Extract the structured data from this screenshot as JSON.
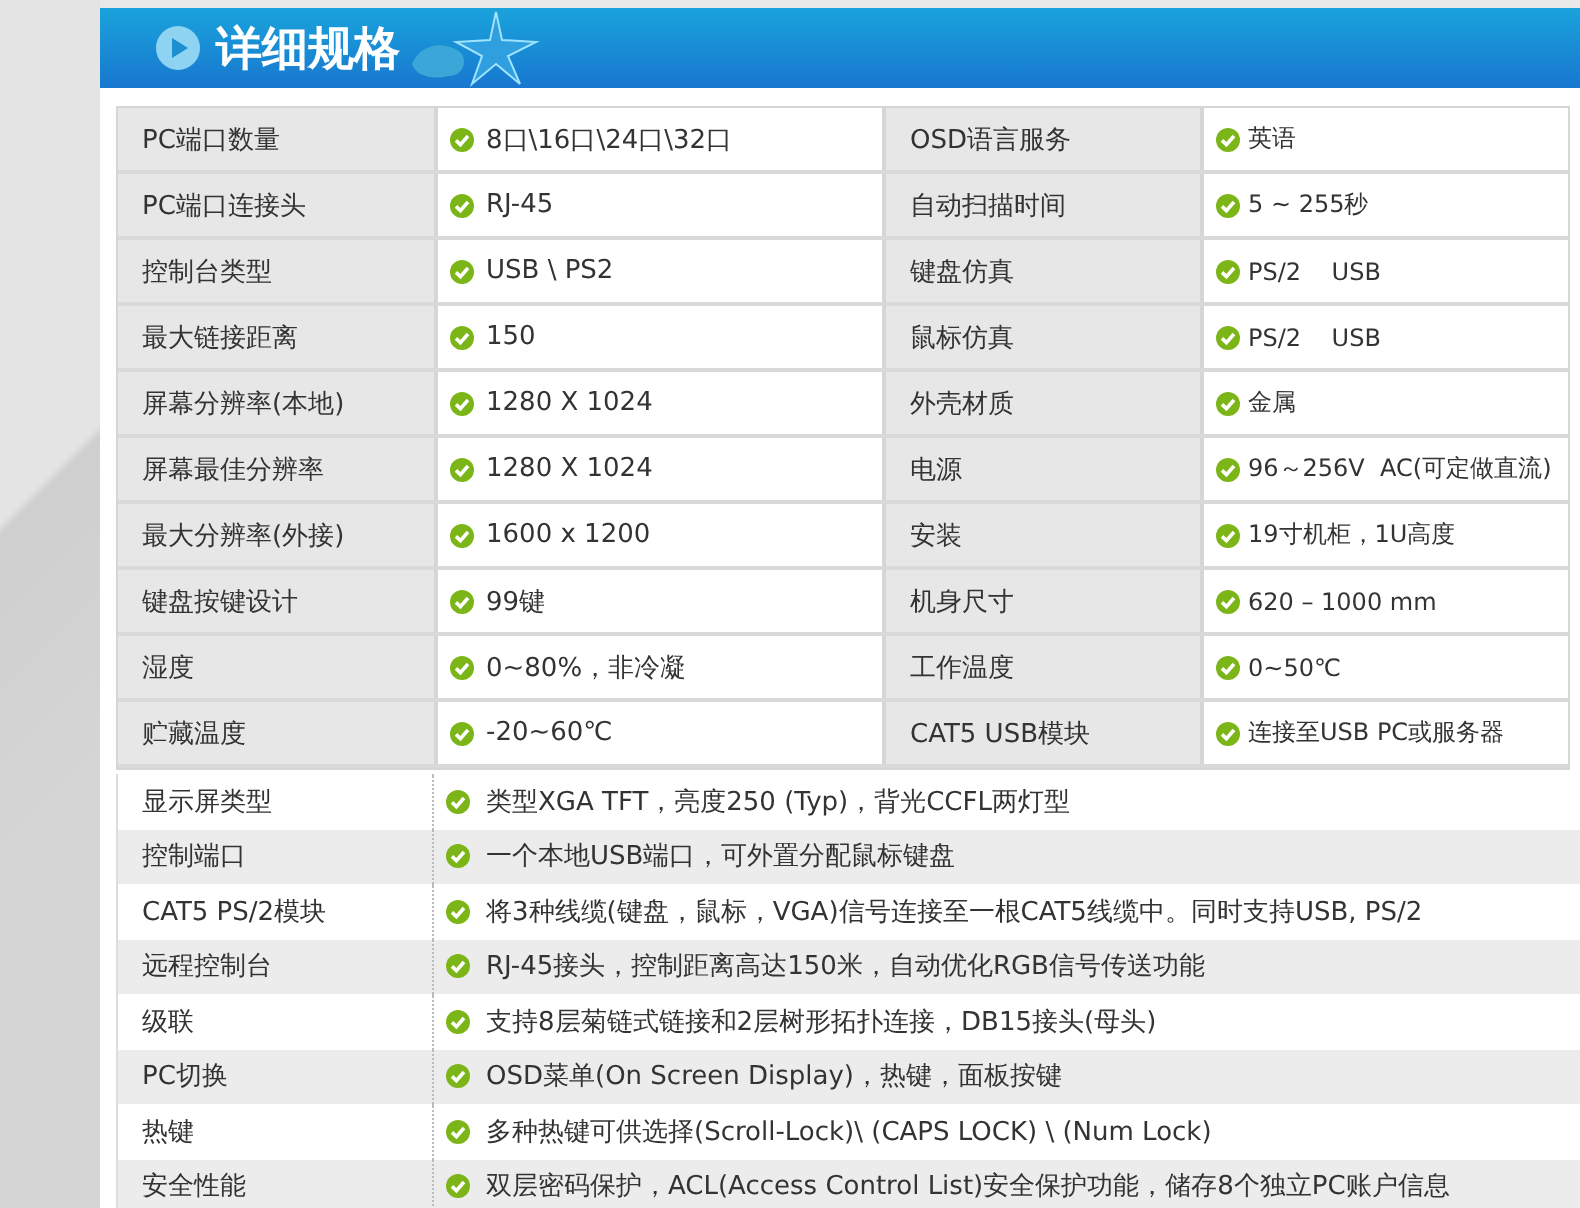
{
  "header": {
    "title": "详细规格"
  },
  "spec_grid": [
    {
      "pairs": [
        {
          "label": "PC端口数量",
          "value": "8口\\16口\\24口\\32口"
        },
        {
          "label": "OSD语言服务",
          "value": "英语"
        }
      ]
    },
    {
      "pairs": [
        {
          "label": "PC端口连接头",
          "value": "RJ-45"
        },
        {
          "label": "自动扫描时间",
          "value": "5 ~ 255秒"
        }
      ]
    },
    {
      "pairs": [
        {
          "label": "控制台类型",
          "value": "USB \\ PS2"
        },
        {
          "label": "键盘仿真",
          "value": "PS/2    USB"
        }
      ]
    },
    {
      "pairs": [
        {
          "label": "最大链接距离",
          "value": "150"
        },
        {
          "label": "鼠标仿真",
          "value": "PS/2    USB"
        }
      ]
    },
    {
      "pairs": [
        {
          "label": "屏幕分辨率(本地)",
          "value": "1280 X 1024"
        },
        {
          "label": "外壳材质",
          "value": "金属"
        }
      ]
    },
    {
      "pairs": [
        {
          "label": "屏幕最佳分辨率",
          "value": "1280 X 1024"
        },
        {
          "label": "电源",
          "value": "96～256V  AC(可定做直流)"
        }
      ]
    },
    {
      "pairs": [
        {
          "label": "最大分辨率(外接)",
          "value": "1600 x 1200"
        },
        {
          "label": "安装",
          "value": "19寸机柜，1U高度"
        }
      ]
    },
    {
      "pairs": [
        {
          "label": "键盘按键设计",
          "value": "99键"
        },
        {
          "label": "机身尺寸",
          "value": "620 – 1000 mm"
        }
      ]
    },
    {
      "pairs": [
        {
          "label": "湿度",
          "value": "0~80%，非冷凝"
        },
        {
          "label": "工作温度",
          "value": "0~50℃"
        }
      ]
    },
    {
      "pairs": [
        {
          "label": "贮藏温度",
          "value": "-20~60℃"
        },
        {
          "label": "CAT5 USB模块",
          "value": "连接至USB PC或服务器"
        }
      ]
    }
  ],
  "spec_list": [
    {
      "label": "显示屏类型",
      "value": "类型XGA TFT，亮度250 (Typ)，背光CCFL两灯型"
    },
    {
      "label": "控制端口",
      "value": "一个本地USB端口，可外置分配鼠标键盘"
    },
    {
      "label": "CAT5 PS/2模块",
      "value": "将3种线缆(键盘，鼠标，VGA)信号连接至一根CAT5线缆中。同时支持USB, PS/2"
    },
    {
      "label": "远程控制台",
      "value": "RJ-45接头，控制距离高达150米，自动优化RGB信号传送功能"
    },
    {
      "label": "级联",
      "value": "支持8层菊链式链接和2层树形拓扑连接，DB15接头(母头)"
    },
    {
      "label": "PC切换",
      "value": "OSD菜单(On Screen Display)，热键，面板按键"
    },
    {
      "label": "热键",
      "value": "多种热键可供选择(Scroll-Lock)\\ (CAPS LOCK) \\ (Num Lock)"
    },
    {
      "label": "安全性能",
      "value": "双层密码保护，ACL(Access Control List)安全保护功能，储存8个独立PC账户信息"
    }
  ]
}
